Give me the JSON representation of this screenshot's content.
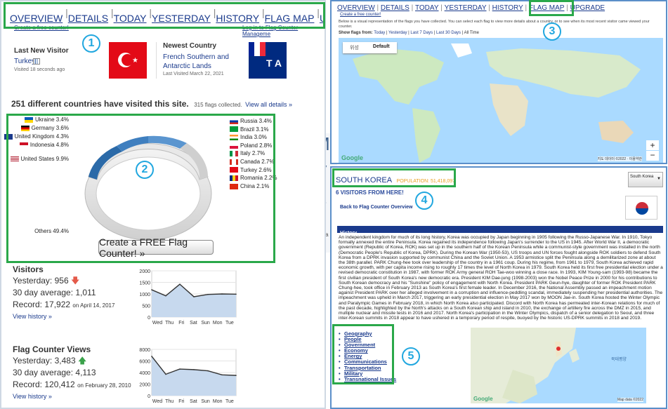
{
  "left": {
    "nav": [
      "OVERVIEW",
      "DETAILS",
      "TODAY",
      "YESTERDAY",
      "HISTORY",
      "FLAG MAP",
      "UPGRADE"
    ],
    "create_link": "Create a free counter!",
    "login_link": "Log in to Flag Counter Manageme",
    "last_visitor": {
      "title": "Last New Visitor",
      "country": "Turkey",
      "ago": "Visited 18 seconds ago"
    },
    "newest_country": {
      "title": "Newest Country",
      "name": "French Southern and Antarctic Lands",
      "date": "Last Visited March 22, 2021"
    },
    "countries_heading": "251 different countries have visited this site.",
    "flags_collected": "315 flags collected.",
    "view_all": "View all details »",
    "legend_left": [
      {
        "country": "Ukraine",
        "pct": "3.4%"
      },
      {
        "country": "Germany",
        "pct": "3.6%"
      },
      {
        "country": "United Kingdom",
        "pct": "4.3%"
      },
      {
        "country": "Indonesia",
        "pct": "4.8%"
      },
      {
        "country": "United States",
        "pct": "9.9%"
      },
      {
        "country": "Others",
        "pct": "49.4%"
      }
    ],
    "legend_right": [
      {
        "country": "Russia",
        "pct": "3.4%"
      },
      {
        "country": "Brazil",
        "pct": "3.1%"
      },
      {
        "country": "India",
        "pct": "3.0%"
      },
      {
        "country": "Poland",
        "pct": "2.8%"
      },
      {
        "country": "Italy",
        "pct": "2.7%"
      },
      {
        "country": "Canada",
        "pct": "2.7%"
      },
      {
        "country": "Turkey",
        "pct": "2.6%"
      },
      {
        "country": "Romania",
        "pct": "2.2%"
      },
      {
        "country": "China",
        "pct": "2.1%"
      }
    ],
    "create_button": "Create a FREE Flag Counter! »",
    "visitors": {
      "title": "Visitors",
      "yesterday": "Yesterday: 956",
      "avg": "30 day average: 1,011",
      "record": "Record: 17,922",
      "record_date": "on April 14, 2017",
      "history": "View history »",
      "y_ticks": [
        "2000",
        "1500",
        "1000",
        "500",
        "0"
      ],
      "days": [
        "Wed",
        "Thu",
        "Fri",
        "Sat",
        "Sun",
        "Mon",
        "Tue"
      ],
      "series": [
        1180,
        920,
        1420,
        880,
        980,
        1000,
        990
      ]
    },
    "views": {
      "title": "Flag Counter Views",
      "yesterday": "Yesterday: 3,483",
      "avg": "30 day average: 4,113",
      "record": "Record: 120,412",
      "record_date": "on February 28, 2010",
      "history": "View history »",
      "y_ticks": [
        "8000",
        "6000",
        "4000",
        "2000",
        "0"
      ],
      "days": [
        "Wed",
        "Thu",
        "Fri",
        "Sat",
        "Sun",
        "Mon",
        "Tue"
      ],
      "series": [
        6800,
        3700,
        4600,
        4500,
        4300,
        3600,
        3500
      ]
    }
  },
  "right_top": {
    "nav": [
      "OVERVIEW",
      "DETAILS",
      "TODAY",
      "YESTERDAY",
      "HISTORY",
      "FLAG MAP",
      "UPGRADE"
    ],
    "create_link": "Create a free counter!",
    "desc": "Below is a visual representation of the flags you have collected. You can select each flag to view more details about a country, or to see when its most recent visitor came viewed your counter.",
    "show_flags": "Show flags from:",
    "ranges": [
      "Today",
      "Yesterday",
      "Last 7 Days",
      "Last 30 Days",
      "All Time"
    ],
    "map_tabs": [
      "위성",
      "Default"
    ],
    "google": "Google",
    "map_footer": "지도 데이터 ©2022 · 이용약관"
  },
  "right_bottom": {
    "country": "SOUTH KOREA",
    "population": "POPULATION: 51,418,097",
    "select_value": "South Korea",
    "visitors_here": "6 VISITORS FROM HERE!",
    "back_link": "Back to Flag Counter Overview",
    "history_title": "History",
    "history_text": "An independent kingdom for much of its long history, Korea was occupied by Japan beginning in 1905 following the Russo-Japanese War. In 1910, Tokyo formally annexed the entire Peninsula. Korea regained its independence following Japan's surrender to the US in 1945. After World War II, a democratic government (Republic of Korea, ROK) was set up in the southern half of the Korean Peninsula while a communist-style government was installed in the north (Democratic People's Republic of Korea, DPRK). During the Korean War (1950-53), US troops and UN forces fought alongside ROK soldiers to defend South Korea from a DPRK invasion supported by communist China and the Soviet Union. A 1953 armistice split the Peninsula along a demilitarized zone at about the 38th parallel. PARK Chung-hee took over leadership of the country in a 1961 coup. During his regime, from 1961 to 1979, South Korea achieved rapid economic growth, with per capita income rising to roughly 17 times the level of North Korea in 1979. South Korea held its first free presidential election under a revised democratic constitution in 1987, with former ROK Army general ROH Tae-woo winning a close race. In 1993, KIM Young-sam (1993-98) became the first civilian president of South Korea's new democratic era. President KIM Dae-jung (1998-2003) won the Nobel Peace Prize in 2000 for his contributions to South Korean democracy and his \"Sunshine\" policy of engagement with North Korea. President PARK Geun-hye, daughter of former ROK President PARK Chung-hee, took office in February 2013 as South Korea's first female leader. In December 2016, the National Assembly passed an impeachment motion against President PARK over her alleged involvement in a corruption and influence-peddling scandal, immediately suspending her presidential authorities. The impeachment was upheld in March 2017, triggering an early presidential election in May 2017 won by MOON Jae-in. South Korea hosted the Winter Olympic and Paralympic Games in February 2018, in which North Korea also participated. Discord with North Korea has permeated inter-Korean relations for much of the past decade, highlighted by the North's attacks on a South Korean ship and island in 2010, the exchange of artillery fire across the DMZ in 2015, and multiple nuclear and missile tests in 2016 and 2017. North Korea's participation in the Winter Olympics, dispatch of a senior delegation to Seoul, and three inter-Korean summits in 2018 appear to have ushered in a temporary period of respite, buoyed by the historic US-DPRK summits in 2018 and 2019.",
    "topics": [
      "Geography",
      "People",
      "Government",
      "Economy",
      "Energy",
      "Communications",
      "Transportation",
      "Military",
      "Transnational Issues"
    ],
    "google": "Google",
    "map_data": "Map data ©2022",
    "map_labels": [
      "북태평양"
    ]
  },
  "behind_letters": [
    "M",
    "V",
    "S"
  ],
  "behind_text": "Mova",
  "callouts": [
    "1",
    "2",
    "3",
    "4",
    "5"
  ],
  "colors": {
    "accent": "#1a3a8c",
    "highlight": "#2aa84a",
    "callout": "#21a7df",
    "panel_border": "#5b8fc9",
    "donut": "#2b6aa8"
  }
}
